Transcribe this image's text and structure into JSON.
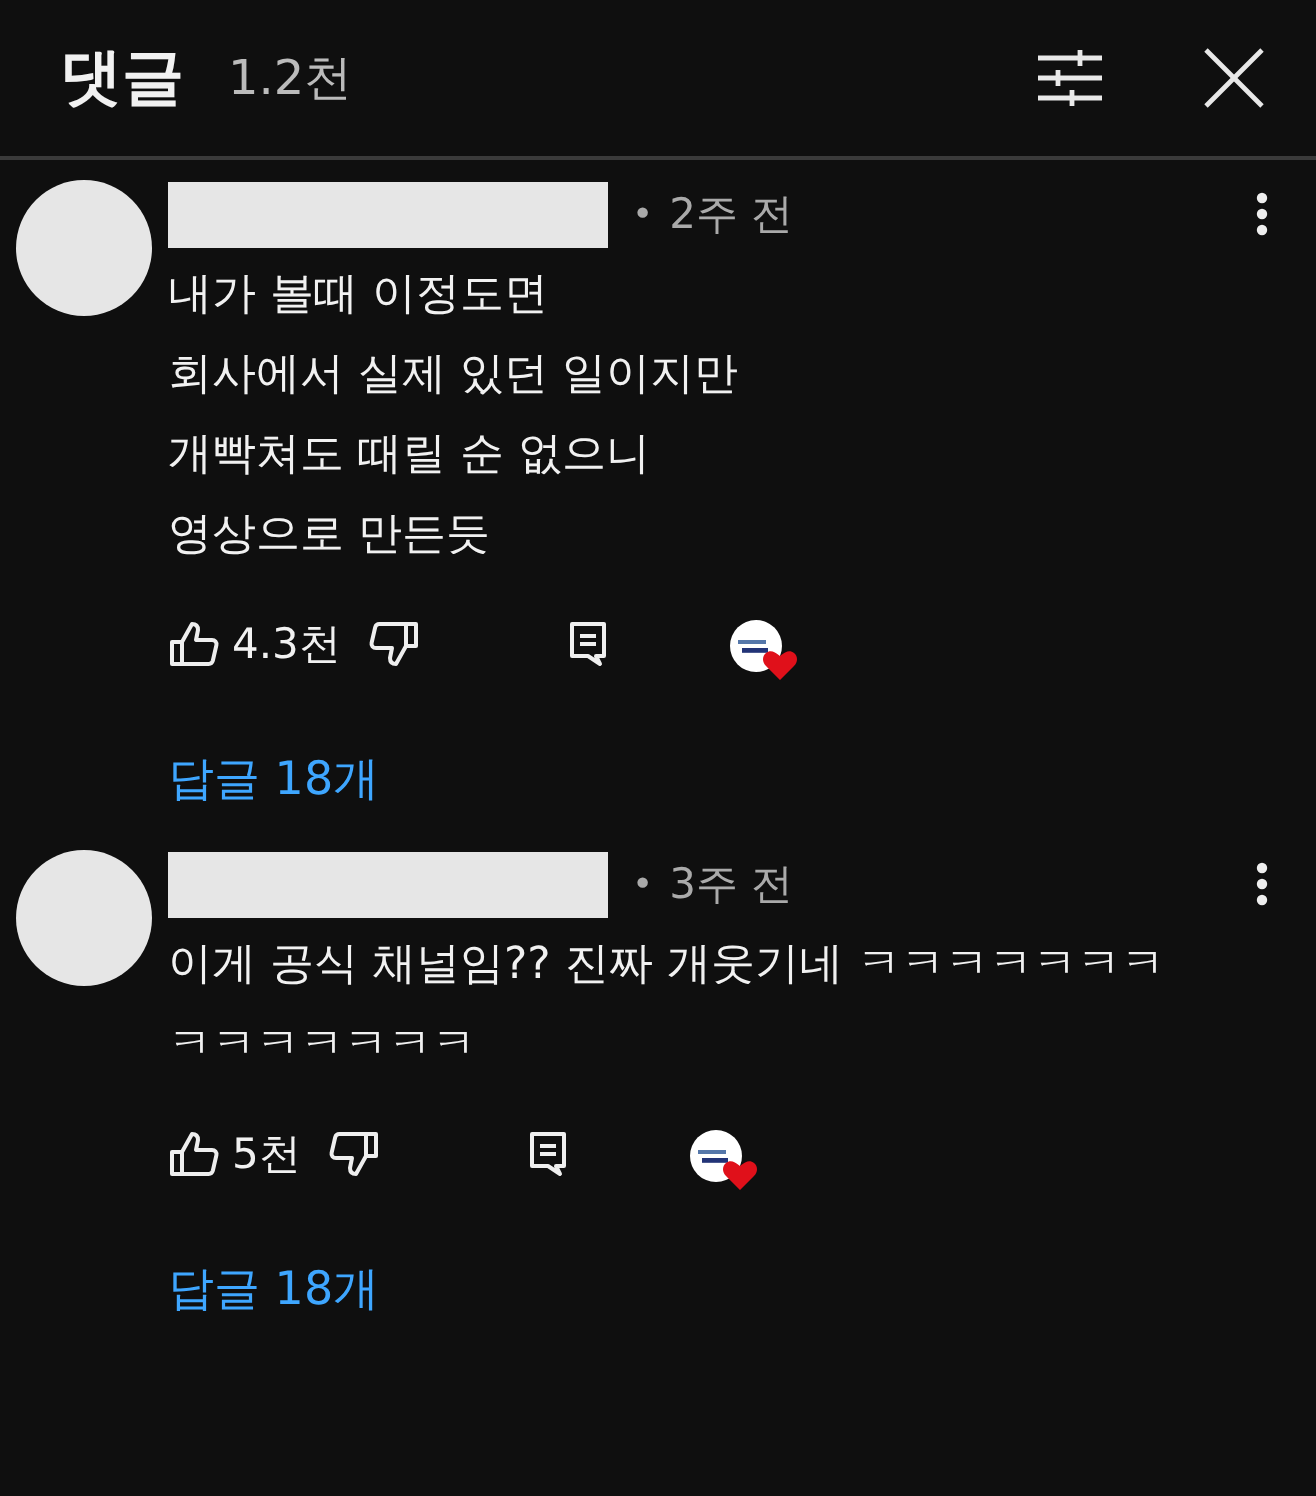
{
  "header": {
    "title": "댓글",
    "count": "1.2천"
  },
  "comments": [
    {
      "separator": "•",
      "time": "2주 전",
      "lines": [
        "내가 볼때 이정도면",
        "회사에서 실제 있던 일이지만",
        "개빡쳐도 때릴 순 없으니",
        "영상으로 만든듯"
      ],
      "likes": "4.3천",
      "hearted": true,
      "replies": "답글 18개"
    },
    {
      "separator": "•",
      "time": "3주 전",
      "lines": [
        "이게 공식 채널임?? 진짜 개웃기네 ㅋㅋㅋㅋㅋㅋㅋ",
        "ㅋㅋㅋㅋㅋㅋㅋ"
      ],
      "likes": "5천",
      "hearted": true,
      "replies": "답글 18개"
    }
  ]
}
